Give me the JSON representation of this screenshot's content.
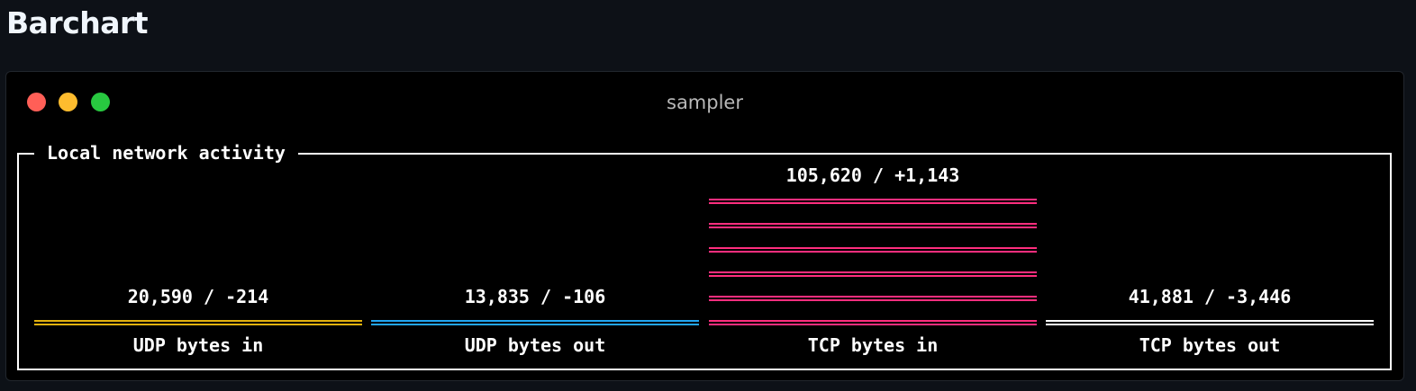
{
  "page": {
    "heading": "Barchart"
  },
  "window": {
    "title": "sampler"
  },
  "panel": {
    "title": "Local network activity"
  },
  "chart_data": {
    "type": "bar",
    "title": "Local network activity",
    "categories": [
      "UDP bytes in",
      "UDP bytes out",
      "TCP bytes in",
      "TCP bytes out"
    ],
    "values": [
      20590,
      13835,
      105620,
      41881
    ],
    "deltas": [
      -214,
      -106,
      1143,
      -3446
    ],
    "value_labels": [
      "20,590 / -214",
      "13,835 / -106",
      "105,620 / +1,143",
      "41,881 / -3,446"
    ],
    "colors": [
      "#e3b20e",
      "#22a6f2",
      "#ff2e7e",
      "#ffffff"
    ],
    "bar_levels": [
      1,
      1,
      6,
      1
    ]
  }
}
